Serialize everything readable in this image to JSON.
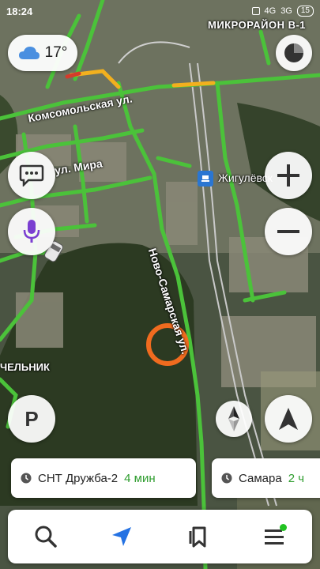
{
  "status_bar": {
    "time": "18:24",
    "network_1": "4G",
    "network_2": "3G",
    "battery": "15"
  },
  "map_labels": {
    "district": "МИКРОРАЙОН В-1",
    "street_komsomolskaya": "Комсомольская ул.",
    "street_mira": "ул. Мира",
    "street_novo_samarskaya": "Ново-Самарская ул.",
    "station": "Жигулёвск",
    "chelnik": "ЧЕЛЬНИК"
  },
  "weather": {
    "temperature": "17°",
    "icon": "cloud-icon"
  },
  "eta_cards": [
    {
      "destination": "СНТ Дружба-2",
      "time": "4 мин"
    },
    {
      "destination": "Самара",
      "time": "2 ч"
    }
  ],
  "colors": {
    "traffic_green": "#4bc23a",
    "traffic_yellow": "#f2b01e",
    "traffic_red": "#d43b2b",
    "target_orange": "#f06b1f",
    "accent_blue": "#2472e3",
    "voice_purple": "#7b3fd1",
    "eta_green": "#2e9d2e"
  },
  "bottom_nav": {
    "items": [
      "search-icon",
      "navigation-arrow-icon",
      "bookmarks-icon",
      "menu-icon"
    ]
  },
  "controls": {
    "parking_label": "P"
  }
}
